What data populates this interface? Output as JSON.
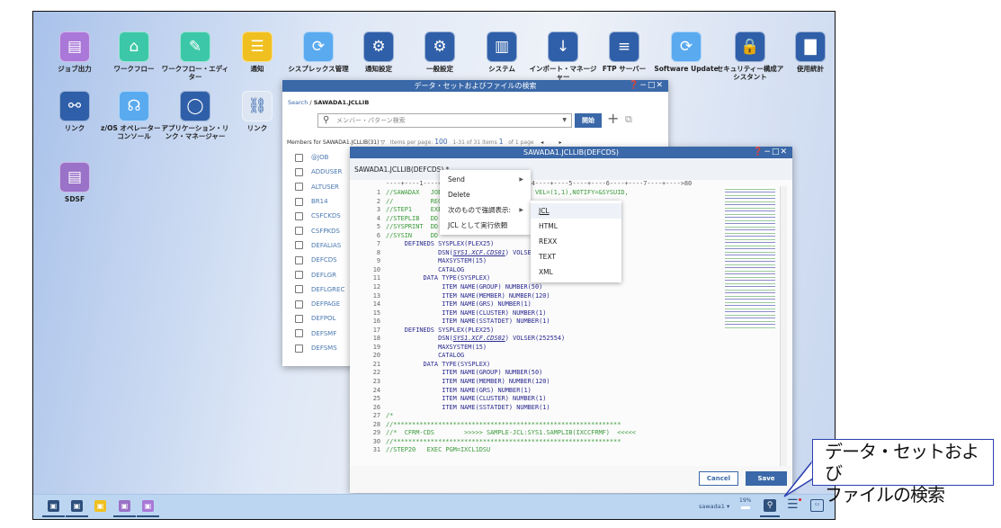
{
  "desktop": {
    "icons": [
      {
        "label": "ジョブ出力",
        "icon": "job-output-icon",
        "glyph": "▤",
        "color": "#a978d8"
      },
      {
        "label": "ワークフロー",
        "icon": "workflow-icon",
        "glyph": "⌂",
        "color": "#3cc8a8"
      },
      {
        "label": "ワークフロー・エディター",
        "icon": "workflow-editor-icon",
        "glyph": "✎",
        "color": "#3cc8a8"
      },
      {
        "label": "通知",
        "icon": "notification-icon",
        "glyph": "☰",
        "color": "#f0c020"
      },
      {
        "label": "シスプレックス管理",
        "icon": "sysplex-icon",
        "glyph": "⟳",
        "color": "#5aaaf0"
      },
      {
        "label": "通知設定",
        "icon": "notification-settings-icon",
        "glyph": "⚙",
        "color": "#2f5fa8"
      },
      {
        "label": "一般設定",
        "icon": "general-settings-icon",
        "glyph": "⚙",
        "color": "#2f5fa8"
      },
      {
        "label": "システム",
        "icon": "system-icon",
        "glyph": "▥",
        "color": "#2f5fa8"
      },
      {
        "label": "インポート・マネージャー",
        "icon": "import-manager-icon",
        "glyph": "↓",
        "color": "#2f5fa8"
      },
      {
        "label": "FTP サーバー",
        "icon": "ftp-server-icon",
        "glyph": "≡",
        "color": "#2f5fa8"
      },
      {
        "label": "Software Update",
        "icon": "software-update-icon",
        "glyph": "⟳",
        "color": "#5aaaf0"
      },
      {
        "label": "セキュリティー構成アシスタント",
        "icon": "security-assistant-icon",
        "glyph": "🔒",
        "color": "#2f5fa8"
      },
      {
        "label": "使用統計",
        "icon": "usage-stats-icon",
        "glyph": "▇",
        "color": "#2f5fa8"
      },
      {
        "label": "リンク",
        "icon": "link-network-icon",
        "glyph": "⚯",
        "color": "#2f5fa8"
      },
      {
        "label": "z/OS オペレーター・コンソール",
        "icon": "headset-icon",
        "glyph": "☊",
        "color": "#5aaaf0"
      },
      {
        "label": "アプリケーション・リンク・マネージャー",
        "icon": "app-link-manager-icon",
        "glyph": "◯",
        "color": "#2f5fa8"
      },
      {
        "label": "リンク",
        "icon": "link-folder-icon",
        "glyph": "⛓",
        "color": "#dde6f2"
      },
      {
        "label": "SDSF",
        "icon": "sdsf-icon",
        "glyph": "▤",
        "color": "#9a72c8"
      }
    ]
  },
  "dataset_window": {
    "title": "データ・セットおよびファイルの検索",
    "breadcrumb_root": "Search",
    "breadcrumb_sep": "/",
    "breadcrumb_current": "SAWADA1.JCLLIB",
    "search_placeholder": "メンバー・パターン検索",
    "start_button": "開始",
    "members_label": "Members for SAWADA1.JCLLIB(31)",
    "items_per_page_label": "Items per page:",
    "items_per_page": "100",
    "range": "1-31 of 31 items",
    "page": "1",
    "of_pages": "of 1 page",
    "members": [
      "@JOB",
      "ADDUSER",
      "ALTUSER",
      "BR14",
      "CSFCKDS",
      "CSFPKDS",
      "DEFALIAS",
      "DEFCDS",
      "DEFLGR",
      "DEFLGREC",
      "DEFPAGE",
      "DEFPOL",
      "DEFSMF",
      "DEFSMS"
    ]
  },
  "editor": {
    "title": "SAWADA1.JCLLIB(DEFCDS)",
    "header": "SAWADA1.JCLLIB(DEFCDS) *",
    "ruler": "----+----1----+----2----+----3----+----4----+----5----+----6----+----7----+---->80",
    "lines": [
      {
        "n": "1",
        "t": "//SAWADAX   JOB                         VEL=(1,1),NOTIFY=&SYSUID,",
        "c": "g"
      },
      {
        "n": "2",
        "t": "//          REG",
        "c": "g"
      },
      {
        "n": "3",
        "t": "//STEP1     EXEC",
        "c": "g"
      },
      {
        "n": "4",
        "t": "//STEPLIB   DD",
        "c": "g"
      },
      {
        "n": "5",
        "t": "//SYSPRINT  DD",
        "c": "g"
      },
      {
        "n": "6",
        "t": "//SYSIN     DD",
        "c": "g"
      },
      {
        "n": "7",
        "t": "     DEFINEDS SYSPLEX(PLEX25)",
        "c": "n"
      },
      {
        "n": "8",
        "t": "              DSN(",
        "dsn": "SYS1.XCF.CDS01",
        "after": ") VOLSER",
        "c": "n"
      },
      {
        "n": "9",
        "t": "              MAXSYSTEM(15)",
        "c": "n"
      },
      {
        "n": "10",
        "t": "              CATALOG",
        "c": "n"
      },
      {
        "n": "11",
        "t": "          DATA TYPE(SYSPLEX)",
        "c": "n"
      },
      {
        "n": "12",
        "t": "               ITEM NAME(GROUP) NUMBER(50)",
        "c": "n"
      },
      {
        "n": "13",
        "t": "               ITEM NAME(MEMBER) NUMBER(120)",
        "c": "n"
      },
      {
        "n": "14",
        "t": "               ITEM NAME(GRS) NUMBER(1)",
        "c": "n"
      },
      {
        "n": "15",
        "t": "               ITEM NAME(CLUSTER) NUMBER(1)",
        "c": "n"
      },
      {
        "n": "16",
        "t": "               ITEM NAME(SSTATDET) NUMBER(1)",
        "c": "n"
      },
      {
        "n": "17",
        "t": "     DEFINEDS SYSPLEX(PLEX25)",
        "c": "n"
      },
      {
        "n": "18",
        "t": "              DSN(",
        "dsn": "SYS1.XCF.CDS02",
        "after": ") VOLSER(252554)",
        "c": "n"
      },
      {
        "n": "19",
        "t": "              MAXSYSTEM(15)",
        "c": "n"
      },
      {
        "n": "20",
        "t": "              CATALOG",
        "c": "n"
      },
      {
        "n": "21",
        "t": "          DATA TYPE(SYSPLEX)",
        "c": "n"
      },
      {
        "n": "22",
        "t": "               ITEM NAME(GROUP) NUMBER(50)",
        "c": "n"
      },
      {
        "n": "23",
        "t": "               ITEM NAME(MEMBER) NUMBER(120)",
        "c": "n"
      },
      {
        "n": "24",
        "t": "               ITEM NAME(GRS) NUMBER(1)",
        "c": "n"
      },
      {
        "n": "25",
        "t": "               ITEM NAME(CLUSTER) NUMBER(1)",
        "c": "n"
      },
      {
        "n": "26",
        "t": "               ITEM NAME(SSTATDET) NUMBER(1)",
        "c": "n"
      },
      {
        "n": "27",
        "t": "/*",
        "c": "g"
      },
      {
        "n": "28",
        "t": "//*************************************************************",
        "c": "g"
      },
      {
        "n": "29",
        "t": "//*  CFRM-CDS        >>>>> SAMPLE-JCL:SYS1.SAMPLIB(IXCCFRMF)  <<<<<",
        "c": "g"
      },
      {
        "n": "30",
        "t": "//*************************************************************",
        "c": "g"
      },
      {
        "n": "31",
        "t": "//STEP20   EXEC PGM=IXCL1DSU",
        "c": "g"
      }
    ],
    "cancel": "Cancel",
    "save": "Save"
  },
  "context_menu": {
    "items": [
      {
        "label": "Send",
        "submenu": true
      },
      {
        "label": "Delete",
        "submenu": false
      },
      {
        "label": "次のもので強調表示:",
        "submenu": true
      },
      {
        "label": "JCL として実行依頼",
        "submenu": false
      }
    ]
  },
  "submenu": {
    "items": [
      "JCL",
      "HTML",
      "REXX",
      "TEXT",
      "XML"
    ],
    "selected": "JCL"
  },
  "taskbar": {
    "apps": [
      {
        "icon": "apps-grid-icon",
        "color": "#2d4f7c"
      },
      {
        "icon": "system-icon",
        "color": "#2d4f7c"
      },
      {
        "icon": "notification-icon",
        "color": "#f0c020"
      },
      {
        "icon": "dataset-search-icon",
        "color": "#9a72c8"
      },
      {
        "icon": "editor-icon",
        "color": "#a978d8"
      }
    ],
    "user": "sawada1 ▾",
    "usage": "19%"
  },
  "callout": {
    "line1": "データ・セットおよび",
    "line2": "ファイルの検索"
  }
}
